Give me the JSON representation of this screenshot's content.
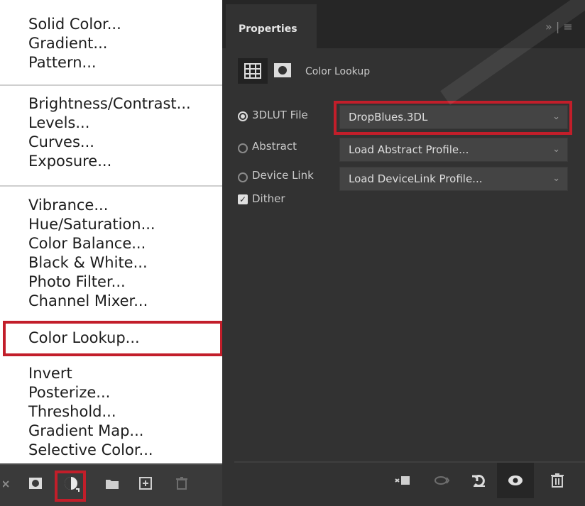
{
  "menu": {
    "group1": [
      "Solid Color...",
      "Gradient...",
      "Pattern..."
    ],
    "group2": [
      "Brightness/Contrast...",
      "Levels...",
      "Curves...",
      "Exposure..."
    ],
    "group3": [
      "Vibrance...",
      "Hue/Saturation...",
      "Color Balance...",
      "Black & White...",
      "Photo Filter...",
      "Channel Mixer...",
      "Color Lookup..."
    ],
    "group4": [
      "Invert",
      "Posterize...",
      "Threshold...",
      "Gradient Map...",
      "Selective Color..."
    ],
    "highlighted_item": "Color Lookup..."
  },
  "layer_toolbar": {
    "icons": [
      "link-icon",
      "mask-icon",
      "adjustment-layer-icon",
      "folder-icon",
      "new-layer-icon",
      "trash-icon"
    ]
  },
  "properties": {
    "tab_label": "Properties",
    "panel_controls": "» | ≡",
    "header_title": "Color Lookup",
    "options": {
      "lut_file": {
        "label": "3DLUT File",
        "value": "DropBlues.3DL",
        "selected": true
      },
      "abstract": {
        "label": "Abstract",
        "value": "Load Abstract Profile...",
        "selected": false
      },
      "device_link": {
        "label": "Device Link",
        "value": "Load DeviceLink Profile...",
        "selected": false
      },
      "dither": {
        "label": "Dither",
        "checked": true
      }
    },
    "footer_icons": [
      "clip-to-layer-icon",
      "view-previous-icon",
      "reset-icon",
      "visibility-icon",
      "delete-icon"
    ]
  },
  "colors": {
    "highlight_red": "#c21e2a",
    "panel_bg": "#323232",
    "dropdown_bg": "#444444"
  }
}
